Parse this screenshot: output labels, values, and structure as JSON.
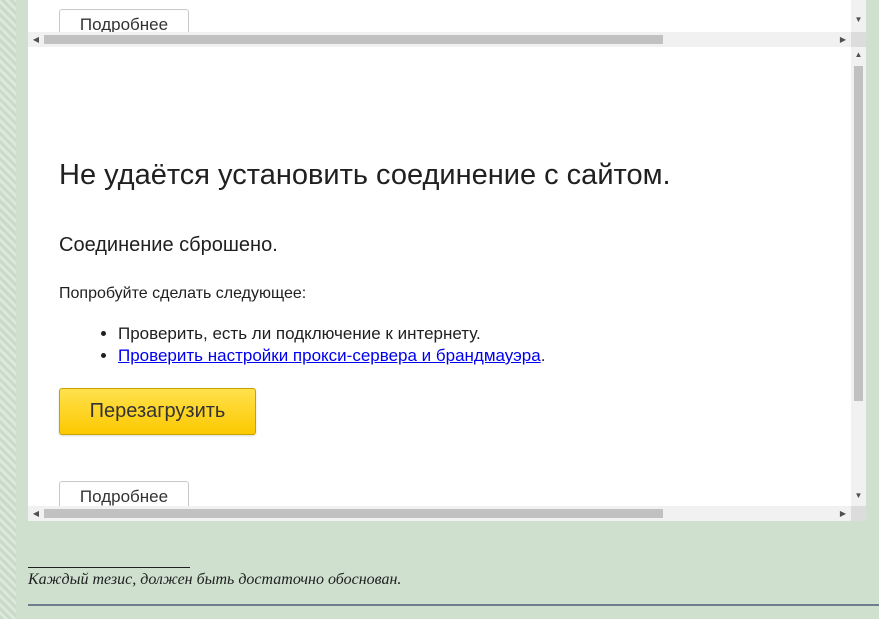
{
  "top_frame": {
    "details_label": "Подробнее"
  },
  "error_page": {
    "title": "Не удаётся установить соединение с сайтом.",
    "subtitle": "Соединение сброшено.",
    "try_label": "Попробуйте сделать следующее:",
    "suggestions": [
      {
        "text": "Проверить, есть ли подключение к интернету.",
        "is_link": false
      },
      {
        "text": "Проверить настройки прокси-сервера и брандмауэра",
        "is_link": true,
        "suffix": "."
      }
    ],
    "reload_label": "Перезагрузить",
    "details_label": "Подробнее"
  },
  "footnote": {
    "text": "Каждый тезис, должен быть достаточно обоснован."
  },
  "icons": {
    "scroll_up": "triangle-up-icon",
    "scroll_down": "triangle-down-icon",
    "scroll_left": "triangle-left-icon",
    "scroll_right": "triangle-right-icon"
  },
  "colors": {
    "page_background": "#cfe0cf",
    "reload_button": "#fcc900",
    "link": "#0000ee"
  }
}
